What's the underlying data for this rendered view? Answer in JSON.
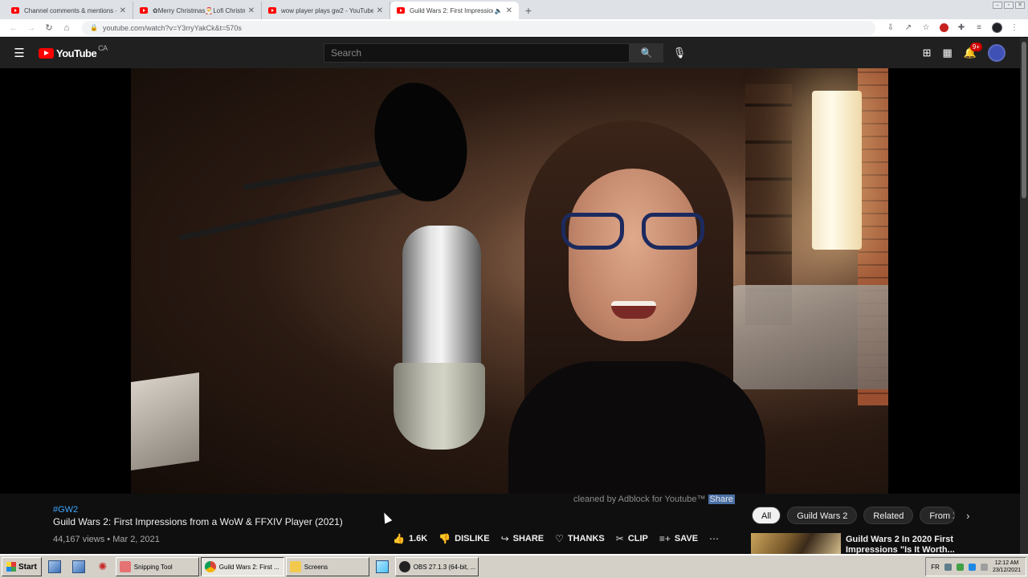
{
  "browser": {
    "tabs": [
      {
        "label": "Channel comments & mentions - You",
        "active": false
      },
      {
        "label": "✿Merry Christmas🎅Lofi Christmas",
        "active": false
      },
      {
        "label": "wow player plays gw2 - YouTube",
        "active": false
      },
      {
        "label": "Guild Wars 2: First Impressions",
        "active": true
      }
    ],
    "url": "youtube.com/watch?v=Y3rryYakCk&t=570s"
  },
  "youtube": {
    "region": "CA",
    "search_placeholder": "Search",
    "notification_count": "9+"
  },
  "overlay": {
    "adblock_text": "cleaned by Adblock for Youtube™",
    "share_label": "Share"
  },
  "video": {
    "hashtag": "#GW2",
    "title": "Guild Wars 2: First Impressions from a WoW & FFXIV Player (2021)",
    "views": "44,167 views",
    "date": "Mar 2, 2021",
    "actions": {
      "likes": "1.6K",
      "dislike": "DISLIKE",
      "share": "SHARE",
      "thanks": "THANKS",
      "clip": "CLIP",
      "save": "SAVE"
    }
  },
  "chips": [
    "All",
    "Guild Wars 2",
    "Related",
    "From X"
  ],
  "related": {
    "title": "Guild Wars 2 In 2020 First Impressions \"Is It Worth..."
  },
  "taskbar": {
    "start": "Start",
    "items": [
      "Snipping Tool",
      "Guild Wars 2: First ...",
      "Screens",
      "OBS 27.1.3 (64-bit, ..."
    ],
    "lang": "FR",
    "time": "12:12 AM",
    "date": "23/12/2021"
  },
  "colors": {
    "yt_red": "#ff0000",
    "yt_bg": "#0f0f0f",
    "link_blue": "#3ea6ff"
  }
}
